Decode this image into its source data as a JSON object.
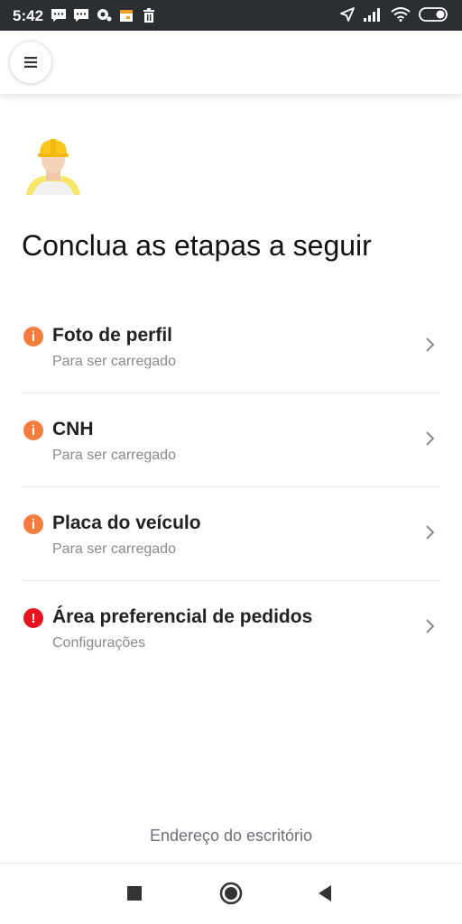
{
  "status_bar": {
    "time": "5:42",
    "left_icons": [
      "message-icon",
      "message-icon",
      "chat-icon",
      "calendar-icon",
      "trash-icon"
    ],
    "right_icons": [
      "location-icon",
      "signal-icon",
      "wifi-icon",
      "battery-icon"
    ]
  },
  "app_bar": {
    "menu_icon": "hamburger-icon"
  },
  "page": {
    "avatar": "driver-helmet-avatar",
    "title": "Conclua as etapas a seguir"
  },
  "steps": [
    {
      "title": "Foto de perfil",
      "subtitle": "Para ser carregado",
      "status": "info",
      "status_color": "#f47c3c"
    },
    {
      "title": "CNH",
      "subtitle": "Para ser carregado",
      "status": "info",
      "status_color": "#f47c3c"
    },
    {
      "title": "Placa do veículo",
      "subtitle": "Para ser carregado",
      "status": "info",
      "status_color": "#f47c3c"
    },
    {
      "title": "Área preferencial de pedidos",
      "subtitle": "Configurações",
      "status": "error",
      "status_color": "#e8141d"
    }
  ],
  "footer": {
    "office_link": "Endereço do escritório"
  },
  "nav_bar": {
    "buttons": [
      "recent-apps",
      "home",
      "back"
    ]
  },
  "colors": {
    "status_bar": "#2b2f33",
    "warning": "#f47c3c",
    "error": "#e8141d",
    "subtitle": "#8a8a8a"
  }
}
